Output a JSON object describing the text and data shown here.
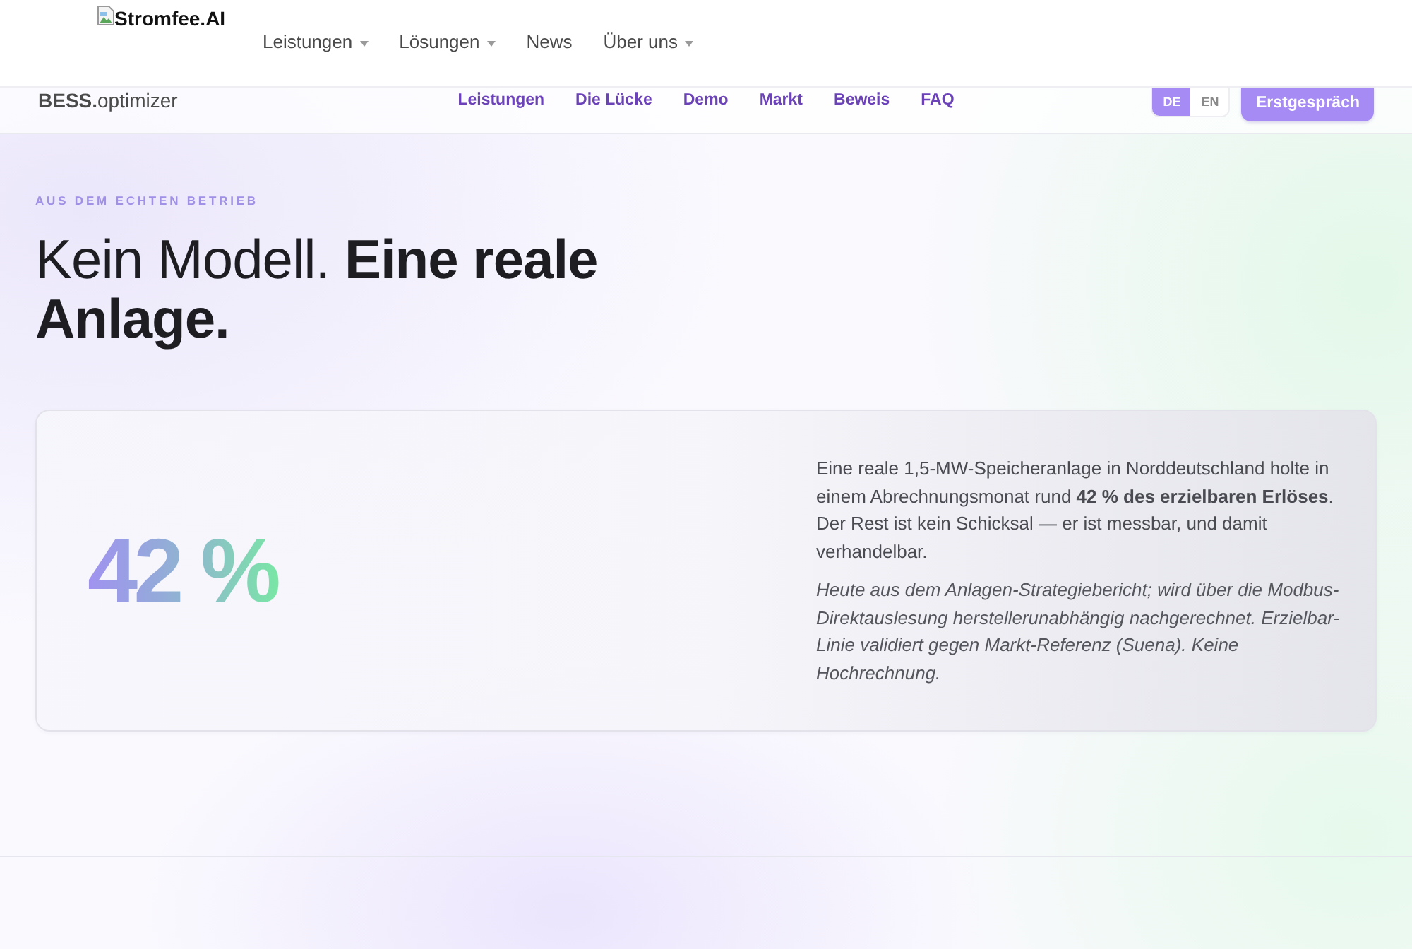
{
  "site_header": {
    "logo": "Stromfee.AI",
    "nav": [
      {
        "label": "Leistungen",
        "has_dropdown": true
      },
      {
        "label": "Lösungen",
        "has_dropdown": true
      },
      {
        "label": "News",
        "has_dropdown": false
      },
      {
        "label": "Über uns",
        "has_dropdown": true
      }
    ]
  },
  "product_bar": {
    "brand": "**BESS.**optimizer",
    "nav": [
      "Leistungen",
      "Die Lücke",
      "Demo",
      "Markt",
      "Beweis",
      "FAQ"
    ],
    "language_switch": [
      {
        "label": "DE",
        "selected": true
      },
      {
        "label": "EN",
        "selected": false
      }
    ],
    "cta_button": "Erstgespräch"
  },
  "hero": {
    "eyebrow": "AUS DEM ECHTEN BETRIEB",
    "headline": "Kein Modell. **Eine reale Anlage.**"
  },
  "stat_card": {
    "figure": "42 %",
    "body": "Eine reale 1,5-MW-Speicheranlage in Norddeutschland holte in einem Abrechnungsmonat rund **42 % des erzielbaren Erlöses**. Der Rest ist kein Schicksal — er ist messbar, und damit verhandelbar.",
    "note": "Heute aus dem Anlagen-Strategiebericht; wird über die Modbus-Direktauslesung herstellerunabhängig nachgerechnet. Erzielbar-Linie validiert gegen Markt-Referenz (Suena). Keine Hochrechnung."
  }
}
